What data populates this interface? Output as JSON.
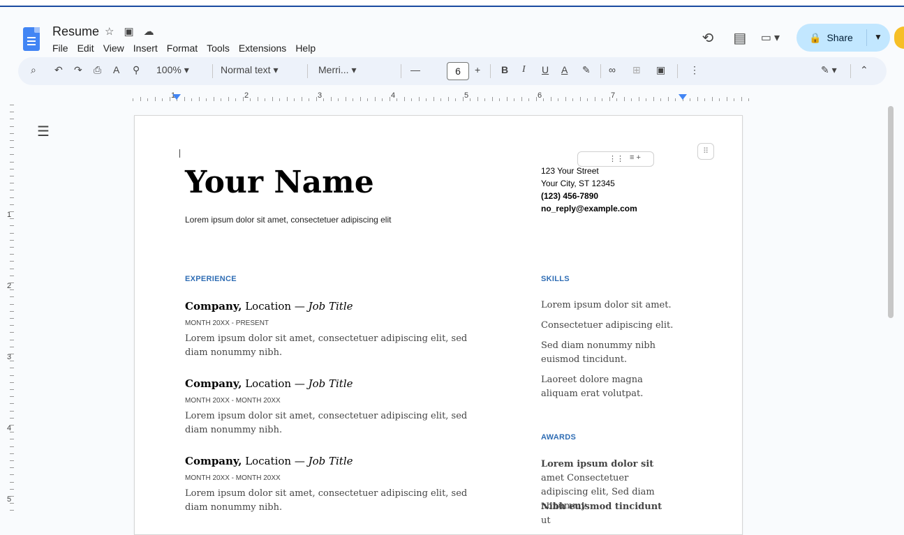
{
  "app": {
    "title": "Resume",
    "menu": [
      "File",
      "Edit",
      "View",
      "Insert",
      "Format",
      "Tools",
      "Extensions",
      "Help"
    ],
    "share_label": "Share"
  },
  "toolbar": {
    "zoom": "100%",
    "style": "Normal text",
    "font": "Merri...",
    "font_size": "6",
    "buttons": [
      "B",
      "I",
      "U",
      "A"
    ]
  },
  "ruler": {
    "labels": [
      "1",
      "2",
      "3",
      "4",
      "5",
      "6",
      "7"
    ]
  },
  "vertical_ruler": {
    "labels": [
      "1",
      "2",
      "3",
      "4",
      "5"
    ]
  },
  "document": {
    "name": "Your Name",
    "tagline": "Lorem ipsum dolor sit amet, consectetuer adipiscing elit",
    "contact": {
      "street": "123 Your Street",
      "city": "Your City, ST 12345",
      "phone": "(123) 456-7890",
      "email": "no_reply@example.com"
    },
    "experience": {
      "heading": "EXPERIENCE",
      "jobs": [
        {
          "company": "Company,",
          "location": " Location — ",
          "title": "Job Title",
          "dates": "MONTH 20XX - PRESENT",
          "description": "Lorem ipsum dolor sit amet, consectetuer adipiscing elit, sed diam nonummy nibh."
        },
        {
          "company": "Company,",
          "location": " Location — ",
          "title": "Job Title",
          "dates": "MONTH 20XX - MONTH 20XX",
          "description": "Lorem ipsum dolor sit amet, consectetuer adipiscing elit, sed diam nonummy nibh."
        },
        {
          "company": "Company,",
          "location": " Location — ",
          "title": "Job Title",
          "dates": "MONTH 20XX - MONTH 20XX",
          "description": "Lorem ipsum dolor sit amet, consectetuer adipiscing elit, sed diam nonummy nibh."
        }
      ]
    },
    "skills": {
      "heading": "SKILLS",
      "items": [
        "Lorem ipsum dolor sit amet.",
        "Consectetuer adipiscing elit.",
        "Sed diam nonummy nibh euismod tincidunt.",
        "Laoreet dolore magna aliquam erat volutpat."
      ]
    },
    "awards": {
      "heading": "AWARDS",
      "entries": [
        {
          "bold": "Lorem ipsum dolor sit",
          "rest": " amet Consectetuer adipiscing elit, Sed diam nonummy"
        },
        {
          "bold": "Nibh euismod tincidunt",
          "rest": " ut"
        }
      ]
    }
  },
  "colors": {
    "accent": "#2f6db4",
    "share_bg": "#c2e7ff",
    "toolbar_bg": "#edf2fa",
    "doc_icon": "#4285f4"
  }
}
